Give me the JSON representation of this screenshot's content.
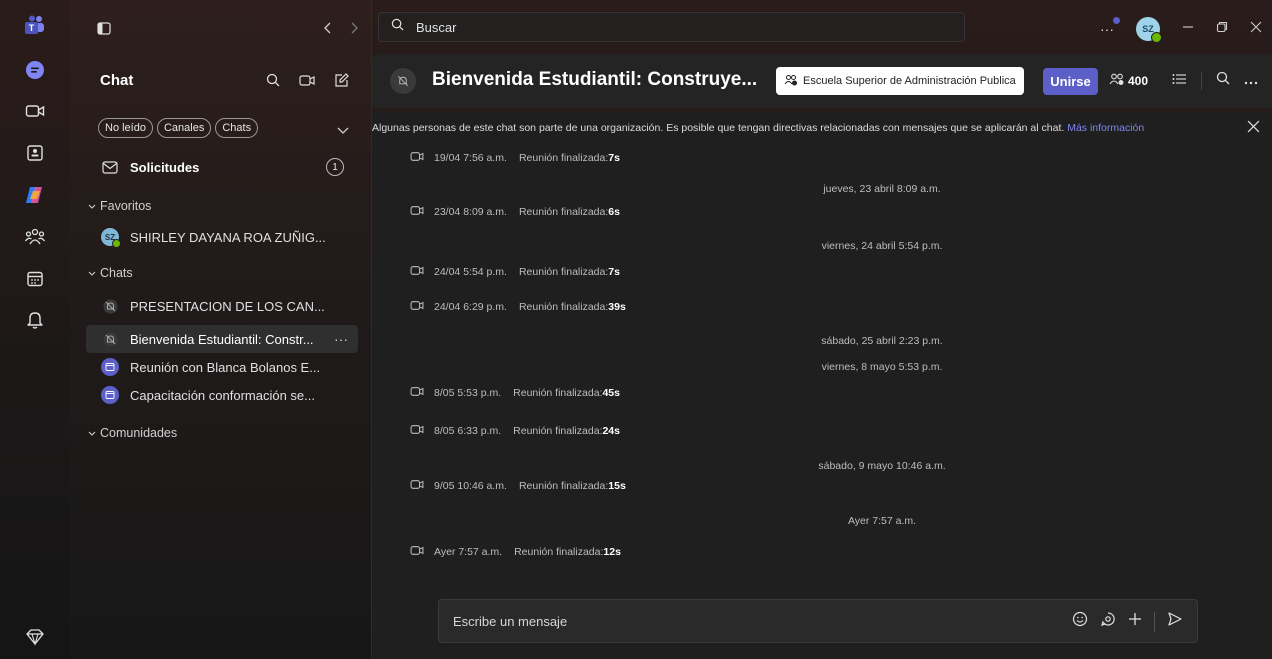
{
  "rail": {
    "items": [
      {
        "name": "teams-logo-icon"
      },
      {
        "name": "chat-icon"
      },
      {
        "name": "meet-icon"
      },
      {
        "name": "assignments-icon"
      },
      {
        "name": "copilot-icon"
      },
      {
        "name": "communities-icon"
      },
      {
        "name": "calendar-icon"
      },
      {
        "name": "activity-bell-icon"
      },
      {
        "name": "premium-diamond-icon"
      }
    ]
  },
  "left": {
    "title": "Chat",
    "filters": [
      "No leído",
      "Canales",
      "Chats"
    ],
    "requests": {
      "label": "Solicitudes",
      "count": "1"
    },
    "favorites_label": "Favoritos",
    "favorites": [
      {
        "label": "SHIRLEY DAYANA ROA ZUÑIG...",
        "initials": "SZ"
      }
    ],
    "chats_label": "Chats",
    "chats": [
      {
        "label": "PRESENTACION DE LOS CAN..."
      },
      {
        "label": "Bienvenida Estudiantil: Constr...",
        "more": "···"
      },
      {
        "label": "Reunión con Blanca Bolanos E..."
      },
      {
        "label": "Capacitación conformación se..."
      }
    ],
    "communities_label": "Comunidades"
  },
  "topbar": {
    "search_placeholder": "Buscar",
    "more": "···",
    "avatar_initials": "SZ"
  },
  "chat": {
    "title": "Bienvenida Estudiantil: Construye...",
    "org": "Escuela Superior de Administración Publica",
    "join_label": "Unirse",
    "participants": "400"
  },
  "banner": {
    "text": "Algunas personas de este chat son parte de una organización. Es posible que tengan directivas relacionadas con mensajes que se aplicarán al chat.",
    "link": "Más información"
  },
  "messages": [
    {
      "kind": "event",
      "time": "19/04 7:56 a.m.",
      "text": "Reunión finalizada:",
      "dur": "7s"
    },
    {
      "kind": "sep",
      "text": "jueves, 23 abril 8:09 a.m."
    },
    {
      "kind": "event",
      "time": "23/04 8:09 a.m.",
      "text": "Reunión finalizada:",
      "dur": "6s"
    },
    {
      "kind": "sep",
      "text": "viernes, 24 abril 5:54 p.m."
    },
    {
      "kind": "event",
      "time": "24/04 5:54 p.m.",
      "text": "Reunión finalizada:",
      "dur": "7s"
    },
    {
      "kind": "event",
      "time": "24/04 6:29 p.m.",
      "text": "Reunión finalizada:",
      "dur": "39s"
    },
    {
      "kind": "sep",
      "text": "sábado, 25 abril 2:23 p.m."
    },
    {
      "kind": "sep",
      "text": "viernes, 8 mayo 5:53 p.m."
    },
    {
      "kind": "event",
      "time": "8/05 5:53 p.m.",
      "text": "Reunión finalizada:",
      "dur": "45s"
    },
    {
      "kind": "event",
      "time": "8/05 6:33 p.m.",
      "text": "Reunión finalizada:",
      "dur": "24s"
    },
    {
      "kind": "sep",
      "text": "sábado, 9 mayo 10:46 a.m."
    },
    {
      "kind": "event",
      "time": "9/05 10:46 a.m.",
      "text": "Reunión finalizada:",
      "dur": "15s"
    },
    {
      "kind": "sep",
      "text": "Ayer 7:57 a.m."
    },
    {
      "kind": "event",
      "time": "Ayer 7:57 a.m.",
      "text": "Reunión finalizada:",
      "dur": "12s"
    }
  ],
  "composer": {
    "placeholder": "Escribe un mensaje"
  },
  "colors": {
    "accent": "#5b5fc7",
    "online": "#6bb700",
    "link": "#7f85f5"
  }
}
